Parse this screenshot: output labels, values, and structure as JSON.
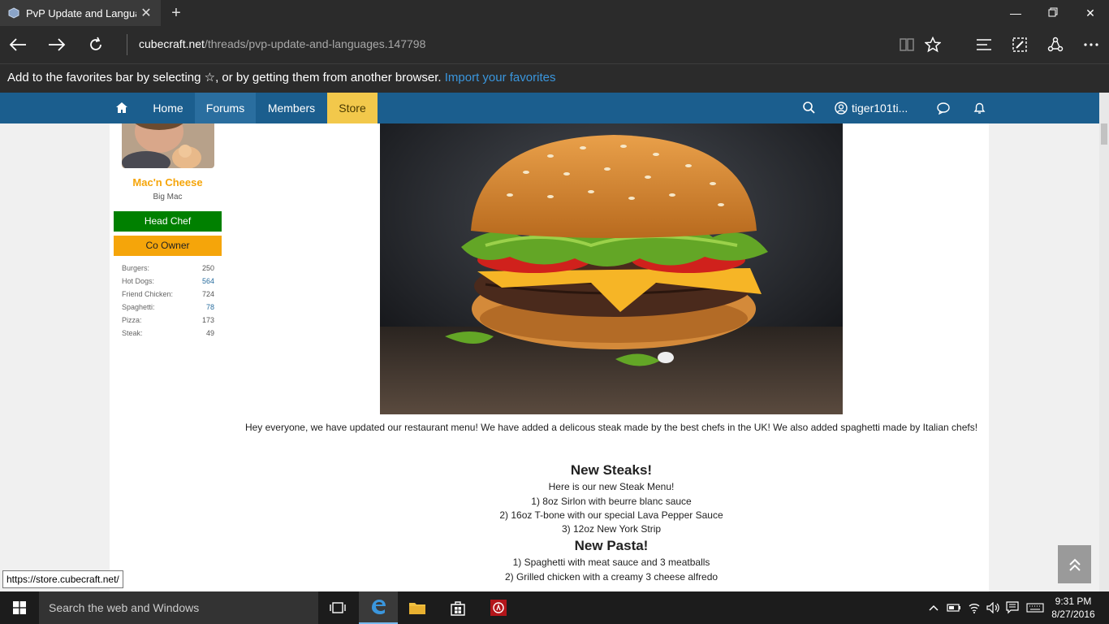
{
  "browser": {
    "tab_title": "PvP Update and Langua",
    "new_tab": "+",
    "url_domain": "cubecraft.net",
    "url_path": "/threads/pvp-update-and-languages.147798",
    "favorites_msg": "Add to the favorites bar by selecting ☆, or by getting them from another browser.",
    "favorites_link": "Import your favorites"
  },
  "site_nav": {
    "items": [
      "Home",
      "Forums",
      "Members",
      "Store"
    ],
    "username": "tiger101ti..."
  },
  "profile": {
    "name": "Mac'n Cheese",
    "title": "Big Mac",
    "banners": [
      {
        "label": "Head Chef",
        "color": "#008000"
      },
      {
        "label": "Co Owner",
        "color": "#f5a50a"
      }
    ],
    "stats": [
      {
        "label": "Burgers:",
        "value": "250"
      },
      {
        "label": "Hot Dogs:",
        "value": "564"
      },
      {
        "label": "Friend Chicken:",
        "value": "724"
      },
      {
        "label": "Spaghetti:",
        "value": "78"
      },
      {
        "label": "Pizza:",
        "value": "173"
      },
      {
        "label": "Steak:",
        "value": "49"
      }
    ]
  },
  "post": {
    "intro": "Hey everyone, we have updated our restaurant menu! We have added a delicous steak made by the best chefs in the UK! We also added spaghetti made by Italian chefs!",
    "steaks_heading": "New Steaks!",
    "steaks_sub": "Here is our new Steak Menu!",
    "steaks": [
      "1) 8oz Sirlon with beurre blanc sauce",
      "2) 16oz T-bone with our special Lava Pepper Sauce",
      "3) 12oz New York Strip"
    ],
    "pasta_heading": "New Pasta!",
    "pasta": [
      "1) Spaghetti with meat sauce and 3 meatballs",
      "2) Grilled chicken with a creamy 3 cheese alfredo"
    ]
  },
  "status_tip": "https://store.cubecraft.net/",
  "taskbar": {
    "search_placeholder": "Search the web and Windows",
    "time": "9:31 PM",
    "date": "8/27/2016"
  },
  "colors": {
    "nav_blue": "#1b5e8e",
    "store_yellow": "#f2c84b",
    "accent_link": "#3a96dd"
  }
}
